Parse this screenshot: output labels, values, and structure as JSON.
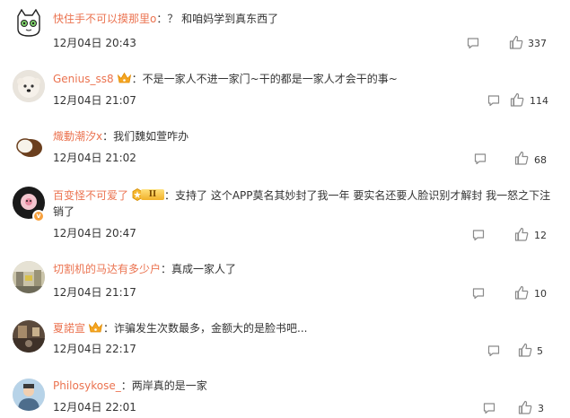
{
  "comments": [
    {
      "username": "快住手不可以摸那里o",
      "separator": "：",
      "text": "？ 和咱妈学到真东西了",
      "time": "12月04日 20:43",
      "likes": "337",
      "crown": false,
      "level_badge": false,
      "verified": false,
      "avatar": "cat-avatar"
    },
    {
      "username": "Genius_ss8",
      "separator": "：",
      "text": "不是一家人不进一家门~干的都是一家人才会干的事~",
      "time": "12月04日 21:07",
      "likes": "114",
      "crown": true,
      "level_badge": false,
      "verified": false,
      "avatar": "dog-avatar"
    },
    {
      "username": "熾動潮汐x",
      "separator": "：",
      "text": "我们魏如萱咋办",
      "time": "12月04日 21:02",
      "likes": "68",
      "crown": false,
      "level_badge": false,
      "verified": false,
      "avatar": "coconut-avatar"
    },
    {
      "username": "百变怪不可爱了",
      "separator": "：",
      "text": "支持了 这个APP莫名其妙封了我一年 要实名还要人脸识别才解封 我一怒之下注销了",
      "time": "12月04日 20:47",
      "likes": "12",
      "crown": false,
      "level_badge": true,
      "level_text": "II",
      "verified": true,
      "avatar": "flower-avatar"
    },
    {
      "username": "切割机的马达有多少户",
      "separator": "：",
      "text": "真成一家人了",
      "time": "12月04日 21:17",
      "likes": "10",
      "crown": false,
      "level_badge": false,
      "verified": false,
      "avatar": "street-avatar"
    },
    {
      "username": "夏諾宣",
      "separator": "：",
      "text": "诈骗发生次数最多，金额大的是脸书吧...",
      "time": "12月04日 22:17",
      "likes": "5",
      "crown": true,
      "level_badge": false,
      "verified": false,
      "avatar": "room-avatar"
    },
    {
      "username": "Philosykose_",
      "separator": "：",
      "text": "两岸真的是一家",
      "time": "12月04日 22:01",
      "likes": "3",
      "crown": false,
      "level_badge": false,
      "verified": false,
      "avatar": "person-avatar"
    }
  ],
  "colors": {
    "username": "#eb7350",
    "text": "#333333",
    "icon": "#8a8a8a",
    "crown": "#f5a623"
  },
  "icons": {
    "reply": "reply-icon",
    "like": "thumbs-up-icon"
  }
}
